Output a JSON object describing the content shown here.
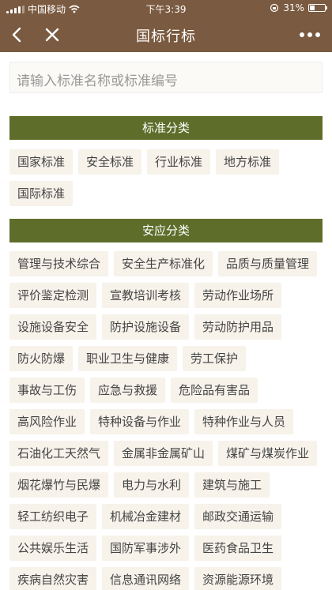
{
  "status": {
    "carrier": "中国移动",
    "time": "下午3:39",
    "battery": "31%",
    "battery_level": 0.31
  },
  "nav": {
    "title": "国标行标",
    "back_icon": "back-chevron-icon",
    "close_icon": "close-icon",
    "more_icon": "more-dots-icon"
  },
  "search": {
    "placeholder": "请输入标准名称或标准编号",
    "value": ""
  },
  "standard_category": {
    "title": "标准分类",
    "items": [
      "国家标准",
      "安全标准",
      "行业标准",
      "地方标准",
      "国际标准"
    ]
  },
  "safety_category": {
    "title": "安应分类",
    "items": [
      "管理与技术综合",
      "安全生产标准化",
      "品质与质量管理",
      "评价鉴定检测",
      "宣教培训考核",
      "劳动作业场所",
      "设施设备安全",
      "防护设施设备",
      "劳动防护用品",
      "防火防爆",
      "职业卫生与健康",
      "劳工保护",
      "事故与工伤",
      "应急与救援",
      "危险品有害品",
      "高风险作业",
      "特种设备与作业",
      "特种作业与人员",
      "石油化工天然气",
      "金属非金属矿山",
      "煤矿与煤炭作业",
      "烟花爆竹与民爆",
      "电力与水利",
      "建筑与施工",
      "轻工纺织电子",
      "机械冶金建材",
      "邮政交通运输",
      "公共娱乐生活",
      "国防军事涉外",
      "医药食品卫生",
      "疾病自然灾害",
      "信息通讯网络",
      "资源能源环境"
    ]
  }
}
